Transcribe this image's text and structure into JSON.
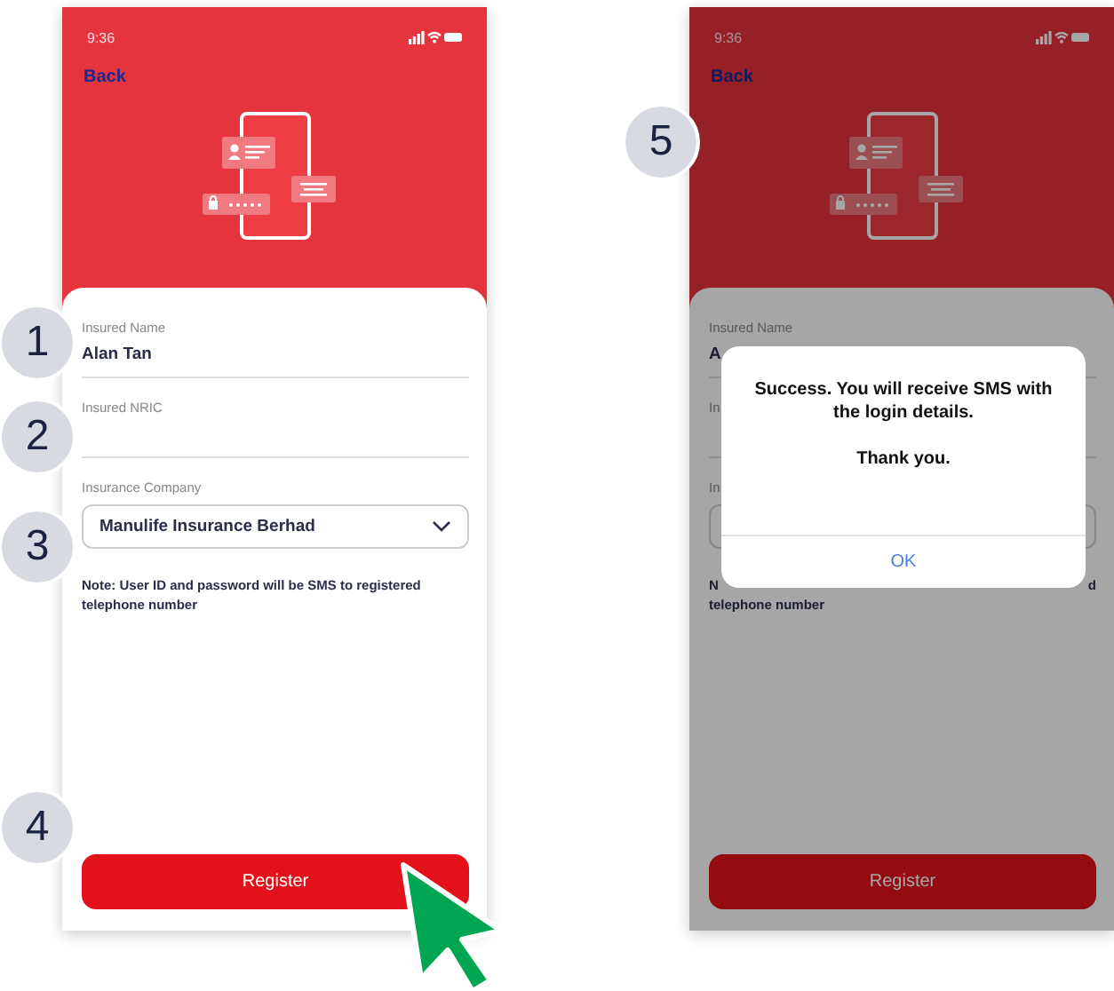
{
  "screens": [
    {
      "dimmed": false,
      "time": "9:36",
      "back": "Back",
      "fields": [
        {
          "kind": "text",
          "label": "Insured Name",
          "value": "Alan Tan"
        },
        {
          "kind": "text",
          "label": "Insured NRIC"
        },
        {
          "kind": "select",
          "label": "Insurance Company",
          "value": "Manulife Insurance Berhad"
        }
      ],
      "note": [
        [
          "Note: User ID and password will be SMS to registered"
        ],
        [
          "telephone number"
        ]
      ],
      "button": "Register"
    },
    {
      "dimmed": true,
      "time": "9:36",
      "back": "Back",
      "fields": [
        {
          "kind": "text",
          "label": "Insured Name",
          "value": "A"
        },
        {
          "kind": "text",
          "label": "In"
        },
        {
          "kind": "select",
          "label": "In"
        }
      ],
      "note": [
        [
          "N",
          "d"
        ],
        [
          "telephone number"
        ]
      ],
      "button": "Register",
      "dialog": {
        "message": "Success. You will receive SMS with the login details.",
        "thanks": "Thank you.",
        "button": "OK"
      }
    }
  ],
  "callouts": [
    {
      "number": "1"
    },
    {
      "number": "2"
    },
    {
      "number": "3"
    },
    {
      "number": "4"
    },
    {
      "number": "5"
    }
  ]
}
